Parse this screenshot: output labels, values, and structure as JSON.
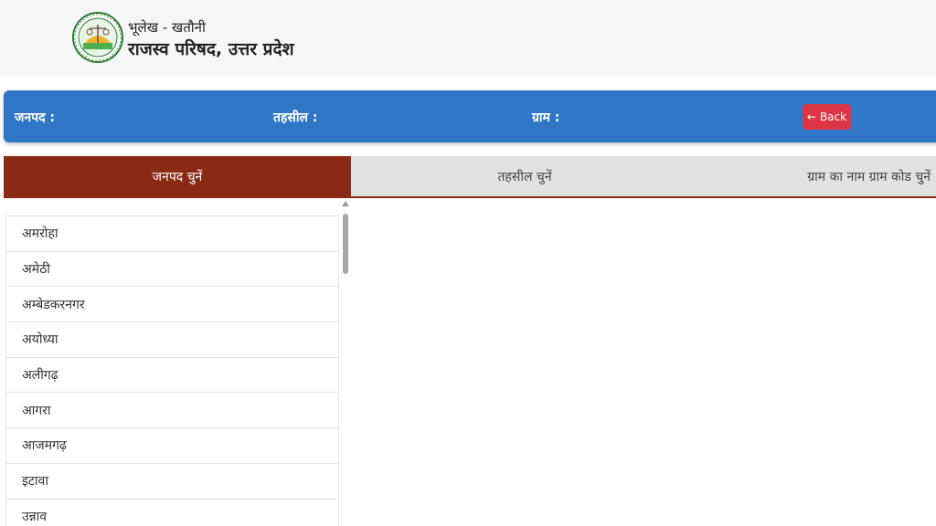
{
  "header": {
    "title_small": "भूलेख - खतौनी",
    "title_big": "राजस्व परिषद, उत्तर प्रदेश",
    "logo_icon": "seal-logo-icon"
  },
  "info_bar": {
    "janpad_label": "जनपद :",
    "tehsil_label": "तहसील :",
    "gram_label": "ग्राम :",
    "back_label": "Back",
    "back_icon": "arrow-left-icon",
    "color": "#2f76c6"
  },
  "tabs": [
    {
      "label": "जनपद चुनें",
      "active": true
    },
    {
      "label": "तहसील चुनें",
      "active": false
    },
    {
      "label": "ग्राम का नाम ग्राम कोड चुनें",
      "active": false
    }
  ],
  "districts": [
    "अमरोहा",
    "अमेठी",
    "अम्बेडकरनगर",
    "अयोध्या",
    "अलीगढ़",
    "आगरा",
    "आजमगढ़",
    "इटावा",
    "उन्नाव"
  ],
  "colors": {
    "active_tab": "#8b2a14",
    "inactive_tab": "#e2e2e2",
    "back_button": "#dc3545"
  }
}
